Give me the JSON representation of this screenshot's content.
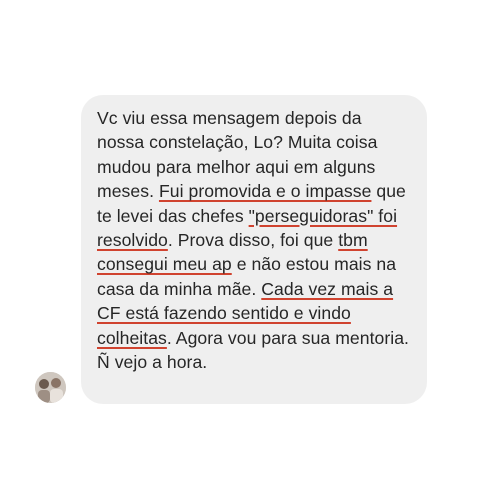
{
  "conversation": {
    "message": {
      "segments": [
        {
          "text": "Vc viu essa mensagem depois da nossa constelação, Lo? Muita coisa mudou para melhor aqui em alguns meses. ",
          "highlighted": false
        },
        {
          "text": "Fui promovida e o impasse",
          "highlighted": true
        },
        {
          "text": " que te levei das chefes ",
          "highlighted": false
        },
        {
          "text": "\"perseguidoras\" foi resolvido",
          "highlighted": true
        },
        {
          "text": ". Prova disso, foi que ",
          "highlighted": false
        },
        {
          "text": "tbm consegui meu ap",
          "highlighted": true
        },
        {
          "text": " e não estou mais na casa da minha mãe. ",
          "highlighted": false
        },
        {
          "text": "Cada vez mais a CF está fazendo sentido e vindo colheitas",
          "highlighted": true
        },
        {
          "text": ". Agora vou para sua mentoria. Ñ vejo a hora.",
          "highlighted": false
        }
      ]
    },
    "sender": {
      "avatar_icon": "user-avatar-photo"
    }
  },
  "colors": {
    "bubble": "#efefef",
    "text": "#262626",
    "highlight_underline": "#d0432f",
    "background": "#ffffff"
  }
}
